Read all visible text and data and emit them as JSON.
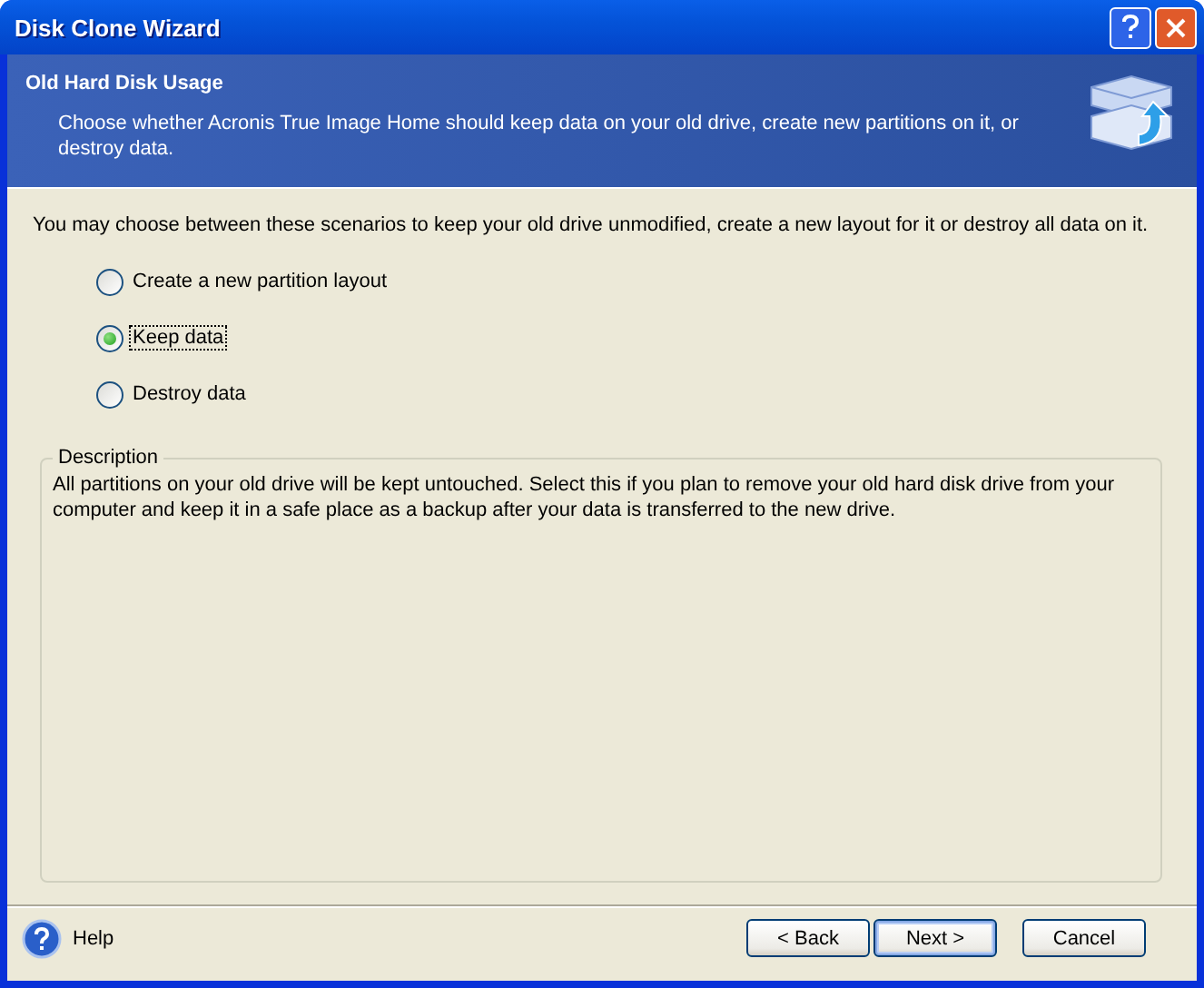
{
  "window": {
    "title": "Disk Clone Wizard"
  },
  "header": {
    "title": "Old Hard Disk Usage",
    "subtitle": "Choose whether Acronis True Image Home should keep data on your old drive, create new partitions on it, or destroy data."
  },
  "intro": "You may choose between these scenarios to keep your old drive unmodified, create a new layout for it or destroy all data on it.",
  "options": [
    {
      "label": "Create a new partition layout",
      "selected": false
    },
    {
      "label": "Keep data",
      "selected": true
    },
    {
      "label": "Destroy data",
      "selected": false
    }
  ],
  "description": {
    "legend": "Description",
    "text": "All partitions on your old drive will be kept untouched. Select this if you plan to remove your old hard disk drive from your computer and keep it in a safe place as a backup after your data is transferred to the new drive."
  },
  "help": "Help",
  "buttons": [
    {
      "label": "< Back",
      "default": false
    },
    {
      "label": "Next >",
      "default": true
    },
    {
      "label": "Cancel",
      "default": false
    }
  ]
}
